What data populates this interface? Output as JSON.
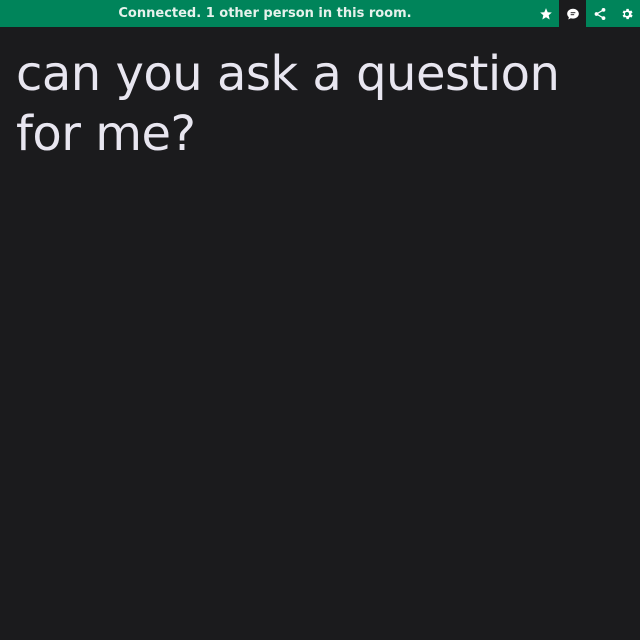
{
  "status_bar": {
    "text": "Connected. 1 other person in this room.",
    "background": "#00845a"
  },
  "toolbar": {
    "buttons": [
      {
        "icon": "star-icon",
        "name": "favorite-button"
      },
      {
        "icon": "chat-bubble-icon",
        "name": "chat-button",
        "active": true
      },
      {
        "icon": "share-icon",
        "name": "share-button"
      },
      {
        "icon": "gear-icon",
        "name": "settings-button"
      }
    ]
  },
  "message": {
    "text": "can you ask a question for me?"
  },
  "colors": {
    "background": "#1b1b1d",
    "text": "#e8e6f0",
    "accent": "#00845a"
  }
}
